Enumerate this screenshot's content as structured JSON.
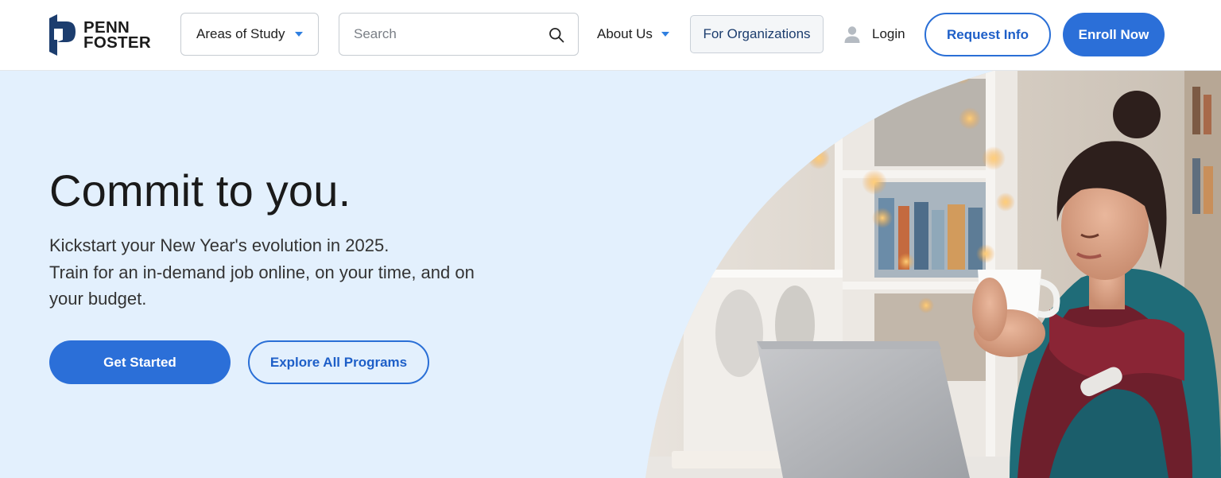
{
  "header": {
    "logo": {
      "line1": "PENN",
      "line2": "FOSTER"
    },
    "areas_of_study": "Areas of Study",
    "search": {
      "placeholder": "Search",
      "value": ""
    },
    "about_us": "About Us",
    "for_organizations": "For Organizations",
    "login": "Login",
    "request_info": "Request Info",
    "enroll_now": "Enroll Now"
  },
  "hero": {
    "title": "Commit to you.",
    "subtitle_lines": [
      "Kickstart your New Year's evolution in 2025.",
      "Train for an in-demand job online, on your time, and on",
      "your budget."
    ],
    "primary_cta": "Get Started",
    "secondary_cta": "Explore All Programs"
  },
  "colors": {
    "accent": "#2b6fd8",
    "hero_background": "#e3f0fd",
    "logo_blue": "#1c3d6e"
  },
  "icons": [
    "penn-foster-logo-icon",
    "chevron-down-icon",
    "search-icon",
    "user-icon"
  ]
}
